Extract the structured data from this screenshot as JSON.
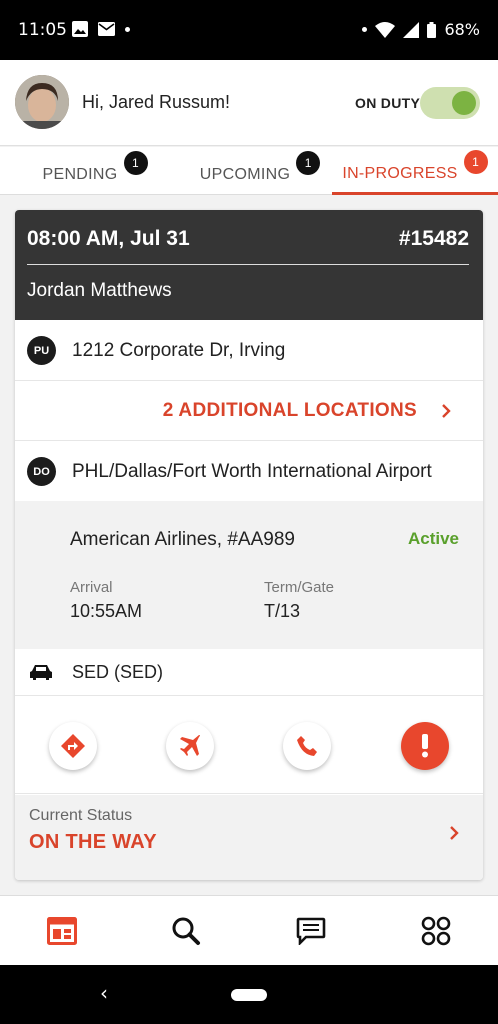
{
  "status_bar": {
    "time": "11:05",
    "battery": "68%"
  },
  "header": {
    "greeting": "Hi, Jared Russum!",
    "duty_label": "ON DUTY",
    "duty_on": true
  },
  "tabs": [
    {
      "label": "PENDING",
      "count": "1"
    },
    {
      "label": "UPCOMING",
      "count": "1"
    },
    {
      "label": "IN-PROGRESS",
      "count": "1",
      "active": true
    }
  ],
  "trip": {
    "datetime": "08:00 AM, Jul 31",
    "number": "#15482",
    "passenger": "Jordan Matthews",
    "pickup": {
      "badge": "PU",
      "address": "1212 Corporate Dr, Irving"
    },
    "additional_locations": "2 ADDITIONAL LOCATIONS",
    "dropoff": {
      "badge": "DO",
      "address": "PHL/Dallas/Fort Worth International Airport"
    },
    "flight": {
      "airline": "American Airlines, #AA989",
      "status": "Active",
      "arrival_label": "Arrival",
      "arrival_value": "10:55AM",
      "gate_label": "Term/Gate",
      "gate_value": "T/13"
    },
    "vehicle": "SED (SED)",
    "current_status_label": "Current Status",
    "current_status_value": "ON THE WAY"
  },
  "colors": {
    "accent": "#d9442b",
    "active_green": "#5aa02c",
    "header_dark": "#353535"
  },
  "icons": [
    "directions-icon",
    "flight-icon",
    "phone-icon",
    "alert-icon",
    "car-icon",
    "trips-icon",
    "search-icon",
    "messages-icon",
    "apps-icon"
  ]
}
